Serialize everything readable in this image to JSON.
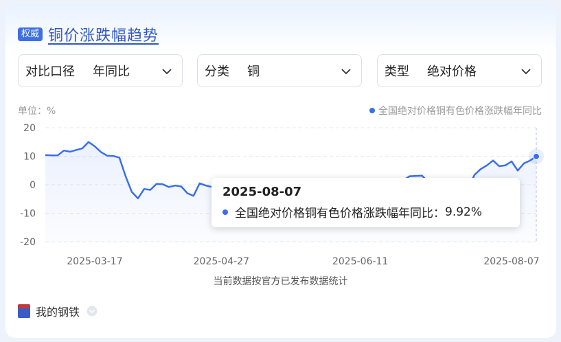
{
  "header": {
    "badge": "权威",
    "title": "铜价涨跌幅趋势"
  },
  "filters": [
    {
      "label": "对比口径",
      "value": "年同比"
    },
    {
      "label": "分类",
      "value": "铜"
    },
    {
      "label": "类型",
      "value": "绝对价格"
    }
  ],
  "unit_text": "单位：%",
  "icons": {
    "dropdown": "chevron-down-icon",
    "legend": "legend-dot-icon",
    "logo": "steel-logo-icon"
  },
  "colors": {
    "accent": "#3a6ef0",
    "title": "#2f56c9",
    "badge": "#3f6fe0"
  },
  "chart_data": {
    "type": "area",
    "ylim": [
      -20,
      20
    ],
    "yticks": [
      "20",
      "10",
      "0",
      "-10",
      "-20"
    ],
    "xtick_labels": [
      "2025-03-17",
      "2025-04-27",
      "2025-06-11",
      "2025-08-07"
    ],
    "series": [
      {
        "name": "全国绝对价格铜有色价格涨跌幅年同比",
        "x": [
          "2025-03-01",
          "2025-03-03",
          "2025-03-05",
          "2025-03-07",
          "2025-03-09",
          "2025-03-11",
          "2025-03-13",
          "2025-03-15",
          "2025-03-17",
          "2025-03-19",
          "2025-03-21",
          "2025-03-23",
          "2025-03-25",
          "2025-03-27",
          "2025-03-29",
          "2025-03-31",
          "2025-04-02",
          "2025-04-04",
          "2025-04-06",
          "2025-04-08",
          "2025-04-10",
          "2025-04-12",
          "2025-04-14",
          "2025-04-16",
          "2025-04-18",
          "2025-04-20",
          "2025-04-22",
          "2025-04-24",
          "2025-04-26",
          "2025-04-28",
          "2025-04-30",
          "2025-05-02",
          "2025-05-04",
          "2025-05-06",
          "2025-05-08",
          "2025-05-10",
          "2025-05-14",
          "2025-05-18",
          "2025-05-22",
          "2025-05-26",
          "2025-05-30",
          "2025-06-03",
          "2025-06-07",
          "2025-06-11",
          "2025-06-15",
          "2025-06-19",
          "2025-06-23",
          "2025-06-27",
          "2025-07-01",
          "2025-07-04",
          "2025-07-07",
          "2025-07-10",
          "2025-07-13",
          "2025-07-16",
          "2025-07-18",
          "2025-07-20",
          "2025-07-22",
          "2025-07-24",
          "2025-07-26",
          "2025-07-28",
          "2025-07-30",
          "2025-08-01",
          "2025-08-03",
          "2025-08-05",
          "2025-08-07"
        ],
        "y": [
          10.4,
          10.3,
          10.3,
          12.0,
          11.6,
          12.2,
          12.8,
          15.0,
          13.5,
          11.5,
          10.2,
          10.1,
          9.5,
          3.0,
          -2.5,
          -4.8,
          -1.5,
          -1.8,
          0.3,
          0.2,
          -0.8,
          -0.3,
          -0.6,
          -3.0,
          -3.9,
          0.5,
          -0.3,
          -0.8,
          -2.5,
          -2.8,
          -3.0,
          -4.2,
          -1.8,
          -2.5,
          -1.2,
          -0.6,
          -1.0,
          -0.8,
          -0.5,
          -0.3,
          -0.7,
          -0.2,
          0.0,
          -0.2,
          -0.1,
          -0.5,
          0.3,
          3.0,
          3.2,
          -0.2,
          -1.2,
          -2.0,
          -1.5,
          -1.0,
          3.5,
          5.5,
          6.8,
          8.5,
          6.5,
          6.8,
          8.2,
          5.0,
          7.5,
          8.5,
          9.92
        ]
      }
    ],
    "tooltip": {
      "date": "2025-08-07",
      "label": "全国绝对价格铜有色价格涨跌幅年同比：",
      "value": "9.92%"
    },
    "footnote": "当前数据按官方已发布数据统计"
  },
  "footer": {
    "text": "我的钢铁"
  }
}
